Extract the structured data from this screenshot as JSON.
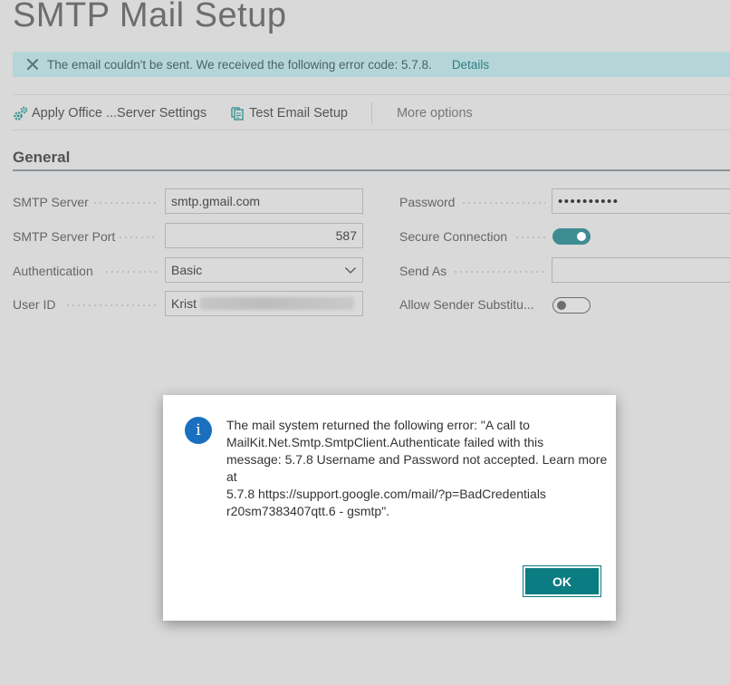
{
  "page": {
    "title": "SMTP Mail Setup"
  },
  "banner": {
    "message": "The email couldn't be sent. We received the following error code: 5.7.8.",
    "details_label": "Details"
  },
  "toolbar": {
    "apply_label": "Apply Office ...Server Settings",
    "test_label": "Test Email Setup",
    "more_label": "More options"
  },
  "section": {
    "title": "General"
  },
  "fields": {
    "smtp_server": {
      "label": "SMTP Server",
      "value": "smtp.gmail.com"
    },
    "smtp_port": {
      "label": "SMTP Server Port",
      "value": "587"
    },
    "authentication": {
      "label": "Authentication",
      "value": "Basic"
    },
    "user_id": {
      "label": "User ID",
      "value": "Krist"
    },
    "password": {
      "label": "Password",
      "value": "••••••••••"
    },
    "secure_connection": {
      "label": "Secure Connection",
      "enabled": true
    },
    "send_as": {
      "label": "Send As",
      "value": ""
    },
    "allow_sender_substitution": {
      "label": "Allow Sender Substitu...",
      "enabled": false
    }
  },
  "dialog": {
    "icon": "info-icon",
    "icon_glyph": "i",
    "message_lines": [
      "The mail system returned the following error: \"A call to",
      "MailKit.Net.Smtp.SmtpClient.Authenticate failed with this",
      "message: 5.7.8 Username and Password not accepted. Learn more",
      "at",
      "5.7.8 https://support.google.com/mail/?p=BadCredentials",
      "r20sm7383407qtt.6 - gsmtp\"."
    ],
    "ok_label": "OK"
  },
  "colors": {
    "banner_bg": "#b5d6d8",
    "accent": "#0b7c82",
    "toggle_on": "#3d8c92",
    "info_icon": "#1b6fbf"
  }
}
